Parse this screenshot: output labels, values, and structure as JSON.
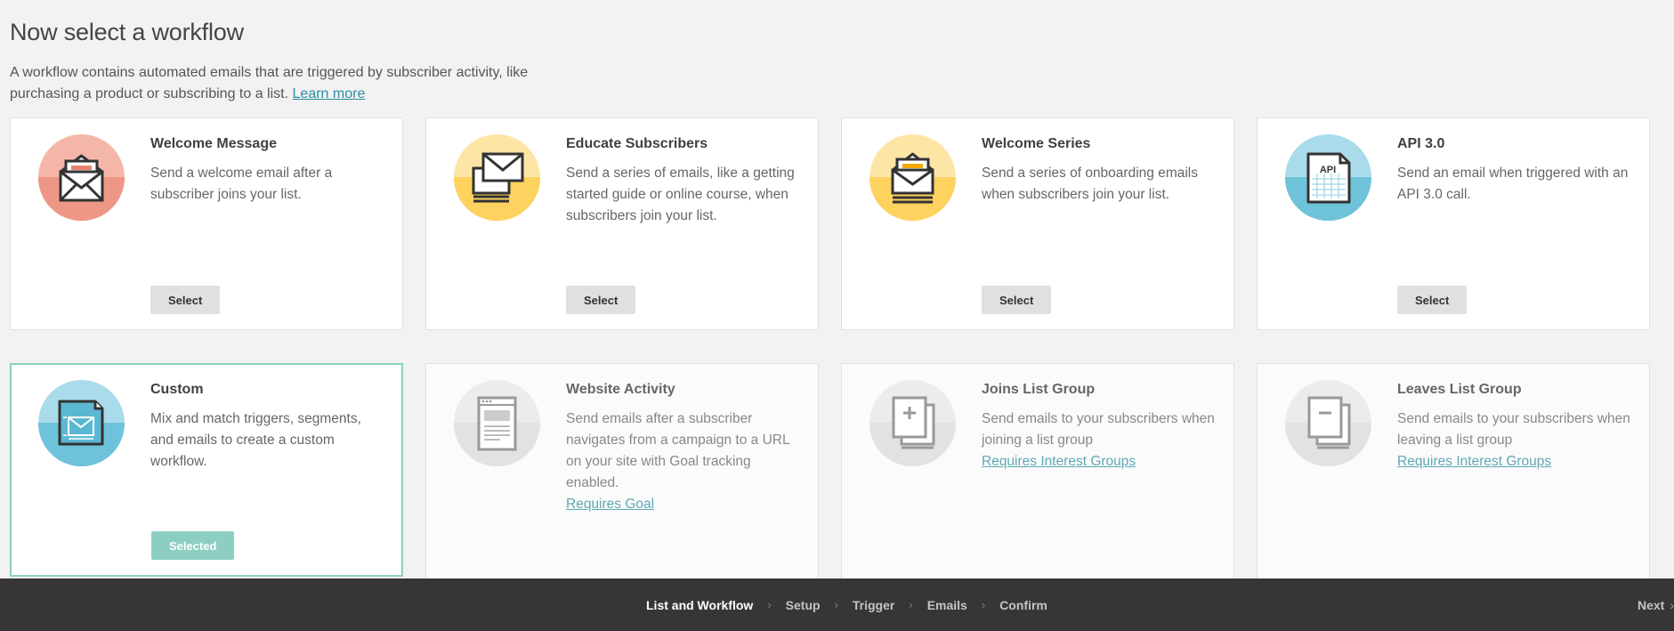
{
  "header": {
    "title": "Now select a workflow",
    "description": "A workflow contains automated emails that are triggered by subscriber activity, like purchasing a product or subscribing to a list.",
    "learn_more": "Learn more"
  },
  "colors": {
    "accent": "#8ccfc2",
    "link": "#2a8ea0",
    "footer_bg": "#363636"
  },
  "cards": [
    {
      "title": "Welcome Message",
      "description": "Send a welcome email after a subscriber joins your list.",
      "button": "Select",
      "icon": "envelope-open-icon"
    },
    {
      "title": "Educate Subscribers",
      "description": "Send a series of emails, like a getting started guide or online course, when subscribers join your list.",
      "button": "Select",
      "icon": "stacked-envelopes-icon"
    },
    {
      "title": "Welcome Series",
      "description": "Send a series of onboarding emails when subscribers join your list.",
      "button": "Select",
      "icon": "envelope-series-icon"
    },
    {
      "title": "API 3.0",
      "description": "Send an email when triggered with an API 3.0 call.",
      "button": "Select",
      "icon": "api-document-icon",
      "icon_label": "API"
    },
    {
      "title": "Custom",
      "description": "Mix and match triggers, segments, and emails to create a custom workflow.",
      "button": "Selected",
      "icon": "custom-blueprint-icon"
    },
    {
      "title": "Website Activity",
      "description": "Send emails after a subscriber navigates from a campaign to a URL on your site with Goal tracking enabled.",
      "link": "Requires Goal",
      "icon": "browser-page-icon"
    },
    {
      "title": "Joins List Group",
      "description": "Send emails to your subscribers when joining a list group",
      "link": "Requires Interest Groups",
      "icon": "add-to-group-icon"
    },
    {
      "title": "Leaves List Group",
      "description": "Send emails to your subscribers when leaving a list group",
      "link": "Requires Interest Groups",
      "icon": "remove-from-group-icon"
    }
  ],
  "footer": {
    "steps": [
      "List and Workflow",
      "Setup",
      "Trigger",
      "Emails",
      "Confirm"
    ],
    "next": "Next"
  }
}
